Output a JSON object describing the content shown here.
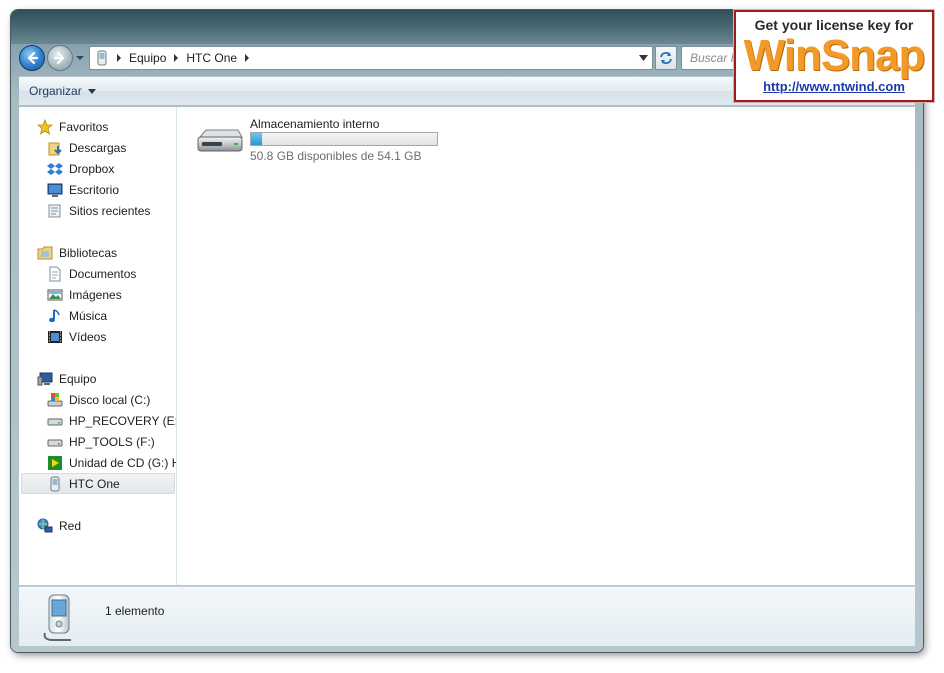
{
  "window": {
    "breadcrumb": [
      "Equipo",
      "HTC One"
    ],
    "search_placeholder": "Buscar HTC One"
  },
  "toolbar": {
    "organize_label": "Organizar"
  },
  "navpane": {
    "favorites": {
      "label": "Favoritos",
      "items": [
        "Descargas",
        "Dropbox",
        "Escritorio",
        "Sitios recientes"
      ]
    },
    "libraries": {
      "label": "Bibliotecas",
      "items": [
        "Documentos",
        "Imágenes",
        "Música",
        "Vídeos"
      ]
    },
    "computer": {
      "label": "Equipo",
      "items": [
        "Disco local (C:)",
        "HP_RECOVERY (E:)",
        "HP_TOOLS (F:)",
        "Unidad de CD (G:) HTC",
        "HTC One"
      ],
      "selected": "HTC One"
    },
    "network": {
      "label": "Red"
    }
  },
  "content": {
    "drive": {
      "name": "Almacenamiento interno",
      "free_text": "50.8 GB disponibles de 54.1 GB",
      "used_fraction": 0.061
    }
  },
  "details": {
    "count_text": "1 elemento"
  },
  "watermark": {
    "top_text": "Get your license key for",
    "logo_text": "WinSnap",
    "url_text": "http://www.ntwind.com"
  }
}
